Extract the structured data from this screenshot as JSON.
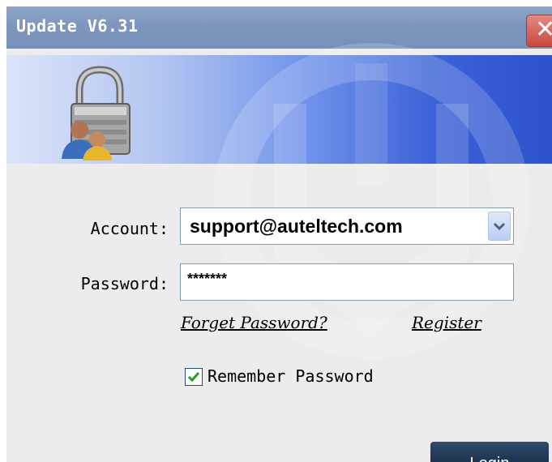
{
  "window": {
    "title": "Update V6.31"
  },
  "form": {
    "account_label": "Account:",
    "account_value": "support@auteltech.com",
    "password_label": "Password:",
    "password_value": "*******",
    "forget_password": "Forget Password?",
    "register": "Register",
    "remember_label": "Remember Password",
    "remember_checked": true,
    "login_label": "Login"
  },
  "icons": [
    "close-icon",
    "lock-users-icon",
    "chevron-down-icon",
    "checkmark-icon"
  ],
  "colors": {
    "titlebar": "#7e96be",
    "banner_start": "#dbe4f9",
    "banner_end": "#2c52cc",
    "close": "#c9483d",
    "login": "#1e344f",
    "check": "#21a121"
  }
}
